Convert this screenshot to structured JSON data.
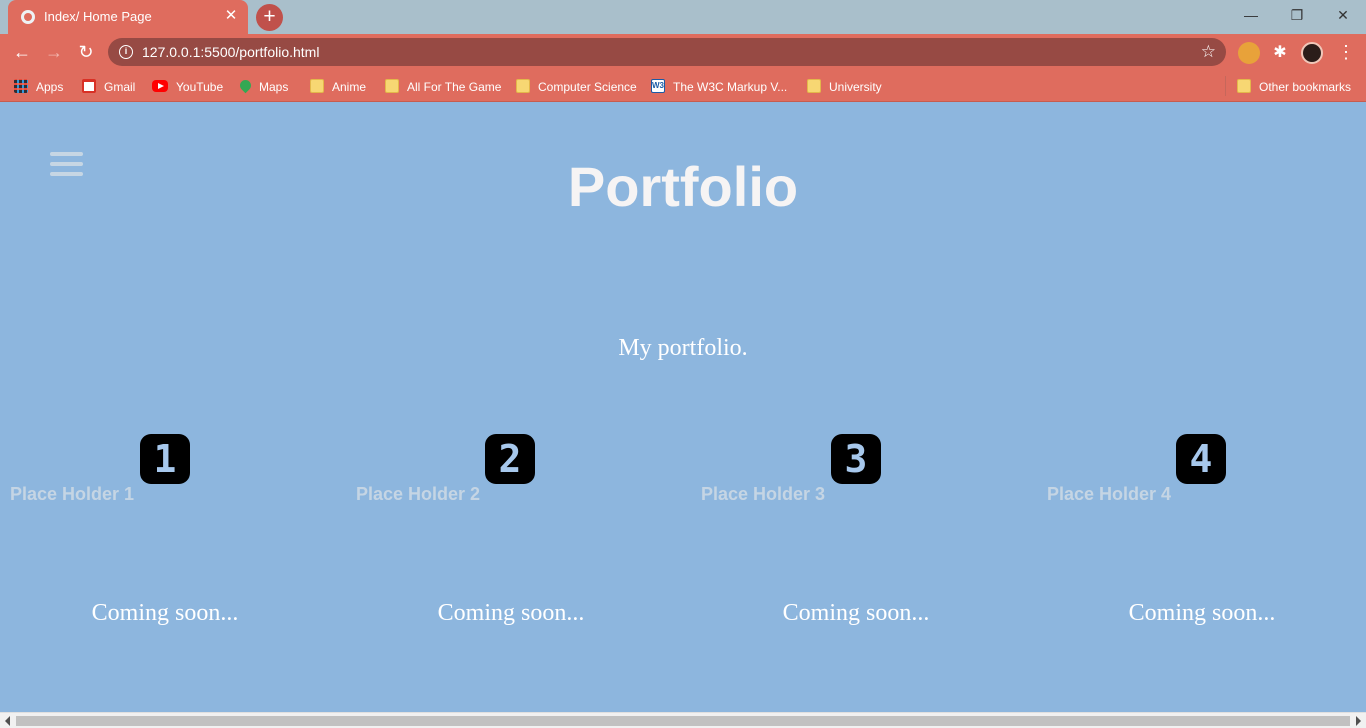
{
  "browser": {
    "tab_title": "Index/ Home Page",
    "tab_close": "✕",
    "new_tab": "+",
    "window_controls": {
      "minimize": "—",
      "restore": "❐",
      "close": "✕"
    },
    "nav": {
      "back": "←",
      "forward": "→",
      "reload": "↻",
      "menu": "⋮"
    },
    "info_icon": "i",
    "url": "127.0.0.1:5500/portfolio.html",
    "star": "☆",
    "extensions": {
      "puzzle": "✱"
    },
    "bookmarks": [
      {
        "label": "Apps",
        "icon": "apps-icon"
      },
      {
        "label": "Gmail",
        "icon": "gmail-icon"
      },
      {
        "label": "YouTube",
        "icon": "youtube-icon"
      },
      {
        "label": "Maps",
        "icon": "maps-icon"
      },
      {
        "label": "Anime",
        "icon": "folder-icon"
      },
      {
        "label": "All For The Game",
        "icon": "folder-icon"
      },
      {
        "label": "Computer Science",
        "icon": "folder-icon"
      },
      {
        "label": "The W3C Markup V...",
        "icon": "w3c-icon"
      },
      {
        "label": "University",
        "icon": "folder-icon"
      }
    ],
    "w3c_glyph": "W3",
    "other_bookmarks": "Other bookmarks"
  },
  "page": {
    "title": "Portfolio",
    "subtitle": "My portfolio.",
    "cards": [
      {
        "number": "1",
        "title": "Place Holder 1",
        "status": "Coming soon..."
      },
      {
        "number": "2",
        "title": "Place Holder 2",
        "status": "Coming soon..."
      },
      {
        "number": "3",
        "title": "Place Holder 3",
        "status": "Coming soon..."
      },
      {
        "number": "4",
        "title": "Place Holder 4",
        "status": "Coming soon..."
      }
    ]
  },
  "colors": {
    "page_background": "#8db6de",
    "chrome_accent": "#df6c5e",
    "number_badge": "#000000"
  }
}
